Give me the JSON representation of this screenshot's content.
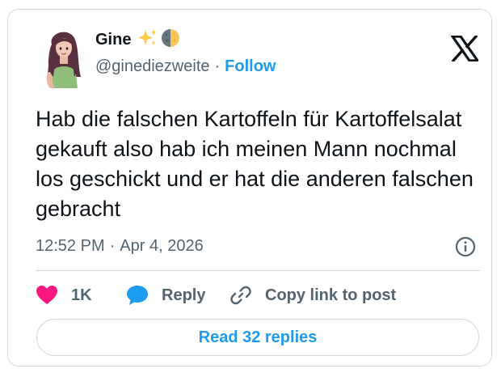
{
  "author": {
    "name": "Gine",
    "emojis": [
      "sparkles-emoji",
      "half-moon-emoji"
    ],
    "handle": "@ginediezweite",
    "separator": "·",
    "follow_label": "Follow"
  },
  "tweet": {
    "text": "Hab die falschen Kartoffeln für Kartoffelsalat gekauft also hab ich meinen Mann nochmal los geschickt und er hat die anderen falschen gebracht",
    "time": "12:52 PM",
    "separator": "·",
    "date": "Apr 4, 2026"
  },
  "actions": {
    "likes": "1K",
    "reply_label": "Reply",
    "copy_label": "Copy link to post"
  },
  "read_replies_label": "Read 32 replies",
  "colors": {
    "accent": "#1d9bf0",
    "like": "#f91880",
    "text": "#0f1419",
    "muted": "#536471",
    "border": "#cfd9de"
  },
  "icons": {
    "logo": "x-logo-icon",
    "info": "info-icon",
    "like": "heart-icon",
    "reply": "speech-bubble-icon",
    "copy": "link-icon"
  }
}
